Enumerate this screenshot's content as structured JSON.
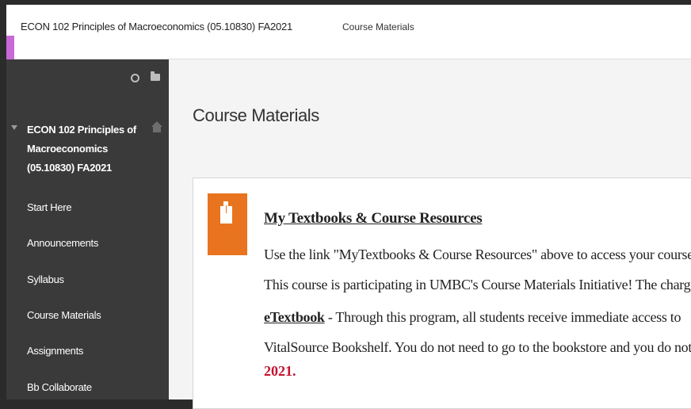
{
  "header": {
    "course_breadcrumb": "ECON 102 Principles of Macroeconomics (05.10830) FA2021",
    "current_page": "Course Materials"
  },
  "sidebar": {
    "course_title": "ECON 102 Principles of Macroeconomics (05.10830) FA2021",
    "items": [
      {
        "label": "Start Here"
      },
      {
        "label": "Announcements"
      },
      {
        "label": "Syllabus"
      },
      {
        "label": "Course Materials"
      },
      {
        "label": "Assignments"
      },
      {
        "label": "Bb Collaborate"
      }
    ]
  },
  "main": {
    "page_title": "Course Materials",
    "item": {
      "title": "My Textbooks & Course Resources",
      "line1": "Use the link \"MyTextbooks & Course Resources\" above to access your course r",
      "line2": "This course is participating in UMBC's Course Materials Initiative! The charg",
      "etextbook_label": "eTextbook",
      "line3_rest": " - Through this program, all students receive immediate access to",
      "line4": "VitalSource Bookshelf. You do not need to go to the bookstore and you do not",
      "date_text": "2021."
    }
  },
  "colors": {
    "accent_tab": "#c86ad6",
    "item_icon": "#e8741f",
    "date_red": "#c8102e",
    "sidebar_bg": "#3a3a3a"
  }
}
